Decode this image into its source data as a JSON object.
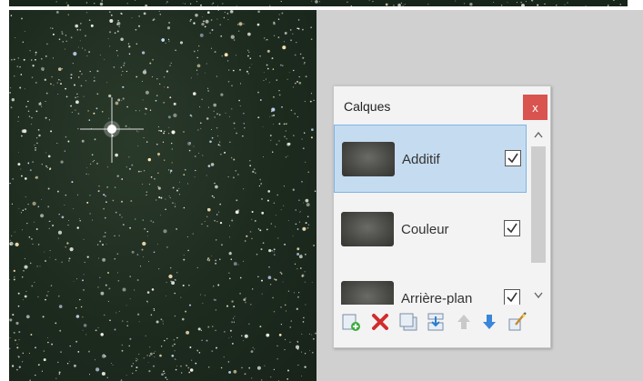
{
  "layers_panel": {
    "title": "Calques",
    "close_label": "x",
    "layers": [
      {
        "name": "Additif",
        "visible": true,
        "selected": true
      },
      {
        "name": "Couleur",
        "visible": true,
        "selected": false
      },
      {
        "name": "Arrière-plan",
        "visible": true,
        "selected": false
      }
    ],
    "toolbar": [
      {
        "icon": "add-layer-icon"
      },
      {
        "icon": "delete-layer-icon"
      },
      {
        "icon": "duplicate-layer-icon"
      },
      {
        "icon": "merge-layer-down-icon"
      },
      {
        "icon": "move-layer-up-icon"
      },
      {
        "icon": "move-layer-down-icon"
      },
      {
        "icon": "layer-properties-icon"
      }
    ]
  },
  "colors": {
    "selection_bg": "#c5dcf0",
    "selection_border": "#7fb4e3",
    "close_button": "#d9534f",
    "workspace": "#d0d0d0"
  }
}
